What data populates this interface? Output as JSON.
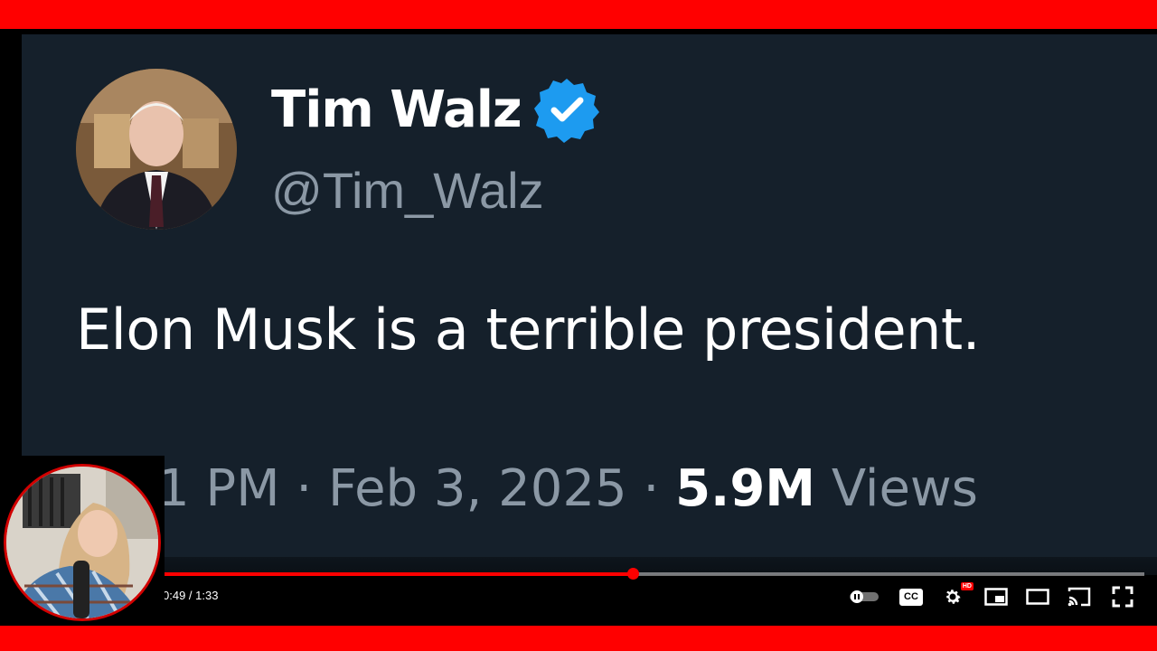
{
  "tweet": {
    "display_name": "Tim Walz",
    "handle": "@Tim_Walz",
    "text": "Elon Musk is a terrible president.",
    "time_partial": "1 PM",
    "separator": "·",
    "date": "Feb 3, 2025",
    "views_count": "5.9M",
    "views_label": "Views"
  },
  "player": {
    "time_display": "0:49 / 1:33",
    "progress_fraction": 0.4786,
    "cc_label": "CC",
    "hd_badge": "HD"
  },
  "icons": {
    "verified": "verified-badge-icon",
    "autoplay": "autoplay-toggle-icon",
    "captions": "captions-icon",
    "settings": "gear-icon",
    "miniplayer": "miniplayer-icon",
    "theater": "theater-mode-icon",
    "cast": "cast-icon",
    "fullscreen": "fullscreen-icon"
  },
  "colors": {
    "frame": "#ff0000",
    "tweet_bg": "#15202b",
    "verified": "#1d9bf0",
    "muted_text": "#8b98a5",
    "progress": "#ff0000"
  }
}
